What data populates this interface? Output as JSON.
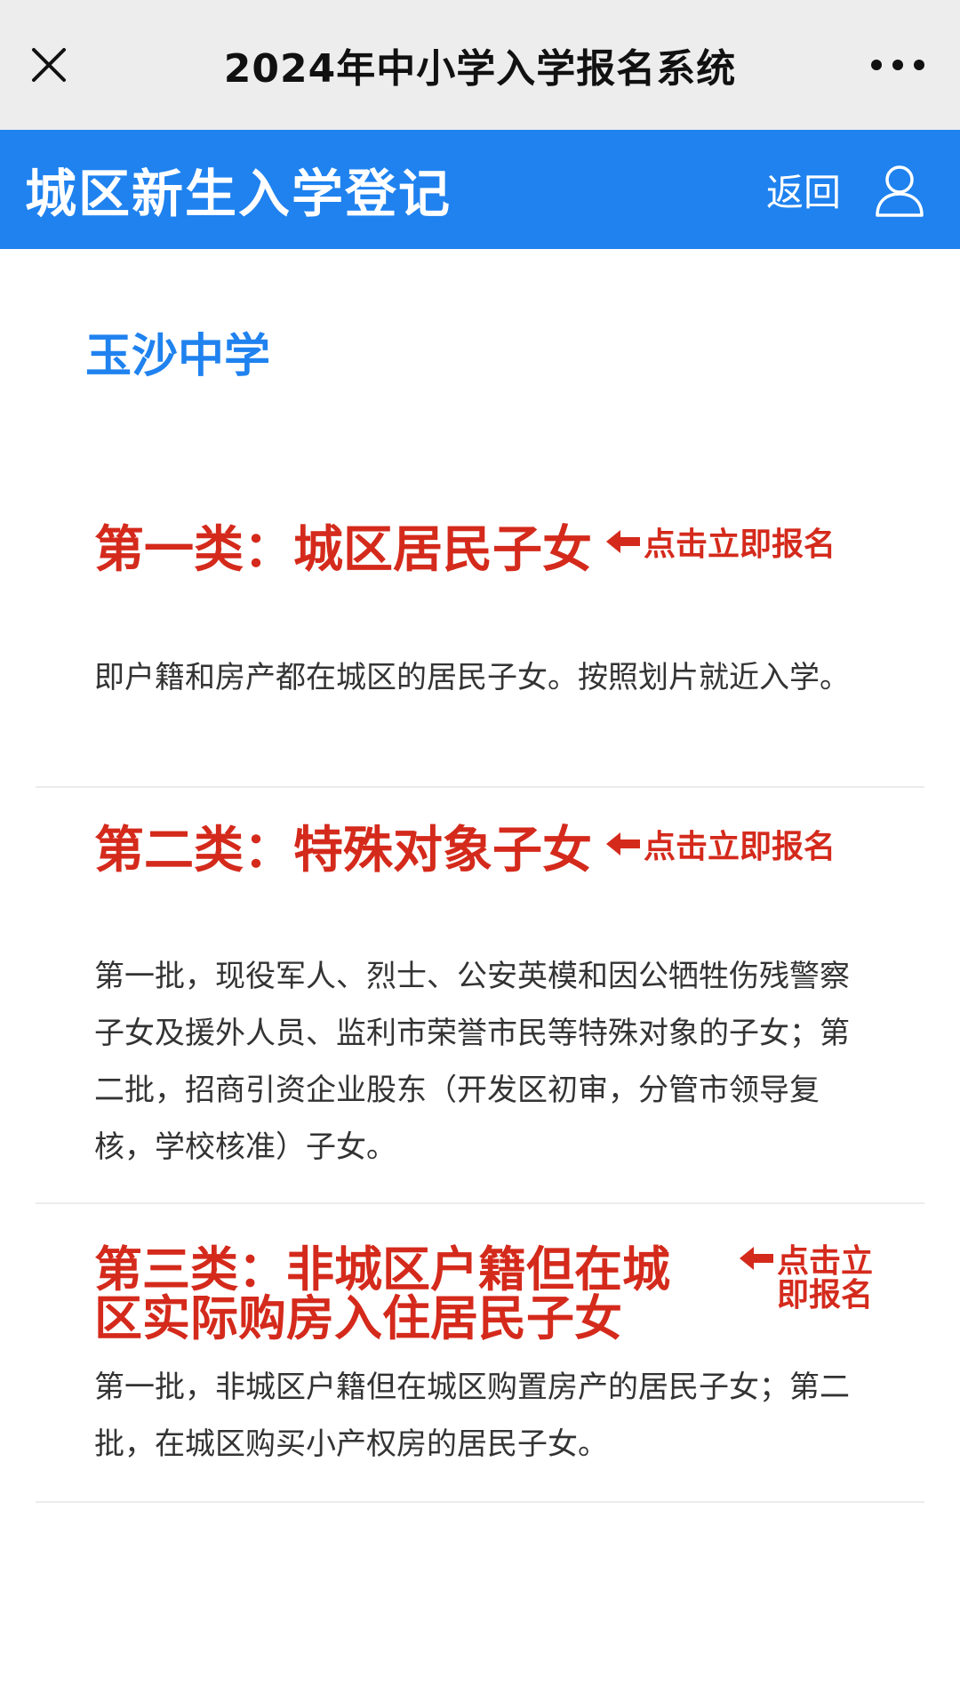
{
  "wechat_bar": {
    "title": "2024年中小学入学报名系统",
    "close_icon": "close-icon",
    "more_icon": "more-dots-icon"
  },
  "header": {
    "title": "城区新生入学登记",
    "back_label": "返回",
    "user_icon": "user-icon",
    "background_color": "#1f82ef"
  },
  "school": {
    "name": "玉沙中学"
  },
  "categories": [
    {
      "title": "第一类：城区居民子女",
      "link_label": "点击立即报名",
      "description": "即户籍和房产都在城区的居民子女。按照划片就近入学。"
    },
    {
      "title": "第二类：特殊对象子女",
      "link_label": "点击立即报名",
      "description": "第一批，现役军人、烈士、公安英模和因公牺牲伤残警察子女及援外人员、监利市荣誉市民等特殊对象的子女；第二批，招商引资企业股东（开发区初审，分管市领导复核，学校核准）子女。"
    },
    {
      "title": "第三类：非城区户籍但在城区实际购房入住居民子女",
      "link_label": "点击立即报名",
      "description": "第一批，非城区户籍但在城区购置房产的居民子女；第二批，在城区购买小产权房的居民子女。"
    }
  ],
  "colors": {
    "accent_blue": "#1f82ef",
    "category_red": "#d42a1c"
  }
}
